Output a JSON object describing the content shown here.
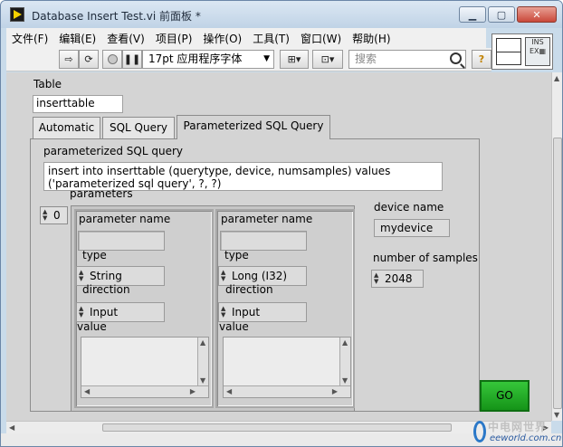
{
  "window": {
    "title": "Database Insert Test.vi 前面板 *",
    "buttons": {
      "minimize": "▁",
      "maximize": "▢",
      "close": "✕"
    }
  },
  "menu": [
    "文件(F)",
    "编辑(E)",
    "查看(V)",
    "项目(P)",
    "操作(O)",
    "工具(T)",
    "窗口(W)",
    "帮助(H)"
  ],
  "toolbar": {
    "font": "17pt 应用程序字体",
    "search_placeholder": "搜索",
    "help_label": "?"
  },
  "vi_icon": {
    "label": "INS"
  },
  "table_control": {
    "label": "Table",
    "value": "inserttable"
  },
  "tabs": [
    {
      "label": "Automatic",
      "active": false
    },
    {
      "label": "SQL Query",
      "active": false
    },
    {
      "label": "Parameterized SQL Query",
      "active": true
    }
  ],
  "query": {
    "label": "parameterized SQL query",
    "value_line1": "insert into inserttable (querytype, device, numsamples) values",
    "value_line2": "('parameterized sql query', ?, ?)"
  },
  "parameters": {
    "label": "parameters",
    "index": "0",
    "items": [
      {
        "name_label": "parameter name",
        "name_value": "",
        "type_label": "type",
        "type_value": "String",
        "direction_label": "direction",
        "direction_value": "Input",
        "value_label": "value"
      },
      {
        "name_label": "parameter name",
        "name_value": "",
        "type_label": "type",
        "type_value": "Long (I32)",
        "direction_label": "direction",
        "direction_value": "Input",
        "value_label": "value"
      }
    ]
  },
  "device": {
    "label": "device name",
    "value": "mydevice"
  },
  "samples": {
    "label": "number of samples",
    "value": "2048"
  },
  "go_button": {
    "label": "GO"
  },
  "watermark": {
    "cn": "中电网世界",
    "en": "eeworld.com.cn"
  }
}
